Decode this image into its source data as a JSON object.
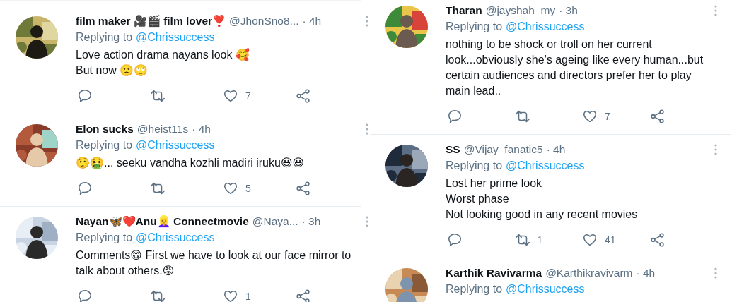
{
  "columns": [
    {
      "tweets": [
        {
          "name": "film maker 🎥🎬 film lover❣️",
          "handle": "@JhonSno8...",
          "time": "· 4h",
          "replying_label": "Replying to",
          "replying_to": "@Chrissuccess",
          "body": [
            "Love action drama nayans look 🥰",
            "But now 🙁🙄"
          ],
          "likes": "7"
        },
        {
          "name": "Elon sucks",
          "handle": "@heist11s",
          "time": "· 4h",
          "replying_label": "Replying to",
          "replying_to": "@Chrissuccess",
          "body": [
            "🤥🤮... seeku vandha kozhli madiri iruku😃😃"
          ],
          "likes": "5"
        },
        {
          "name": "Nayan🦋❤️Anu👱‍♀️ Connectmovie",
          "handle": "@Naya...",
          "time": "· 3h",
          "replying_label": "Replying to",
          "replying_to": "@Chrissuccess",
          "body": [
            "Comments😁 First we have to look at our face mirror to talk about others.😡"
          ],
          "likes": "1"
        }
      ]
    },
    {
      "tweets": [
        {
          "name": "Tharan",
          "handle": "@jayshah_my",
          "time": "· 3h",
          "replying_label": "Replying to",
          "replying_to": "@Chrissuccess",
          "body": [
            "nothing to be shock or troll on her current look...obviously she's ageing like every human...but certain audiences and directors prefer her to play main lead.."
          ],
          "likes": "7"
        },
        {
          "name": "SS",
          "handle": "@Vijay_fanatic5",
          "time": "· 4h",
          "replying_label": "Replying to",
          "replying_to": "@Chrissuccess",
          "body": [
            "Lost her prime look",
            "Worst phase",
            "Not looking good in any recent movies"
          ],
          "retweets": "1",
          "likes": "41"
        },
        {
          "name": "Karthik Ravivarma",
          "handle": "@Karthikravivarm",
          "time": "· 4h",
          "replying_label": "Replying to",
          "replying_to": "@Chrissuccess"
        }
      ]
    }
  ]
}
